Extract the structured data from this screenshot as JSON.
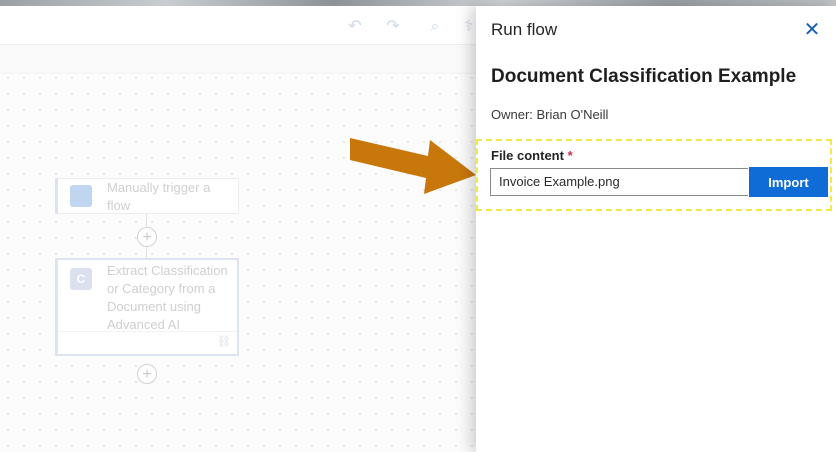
{
  "panel": {
    "title": "Run flow",
    "flow_name": "Document Classification Example",
    "owner": "Owner: Brian O'Neill",
    "field_label": "File content",
    "required_mark": "*",
    "field_value": "Invoice Example.png",
    "import_label": "Import"
  },
  "canvas": {
    "trigger_title": "Manually trigger a\nflow",
    "action_icon_letter": "C",
    "action_title": "Extract Classification\nor Category from a\nDocument using\nAdvanced AI"
  },
  "colors": {
    "accent": "#0f6cd6",
    "highlight": "#f2e84a",
    "arrow": "#c8780a",
    "required": "#c4314b"
  }
}
